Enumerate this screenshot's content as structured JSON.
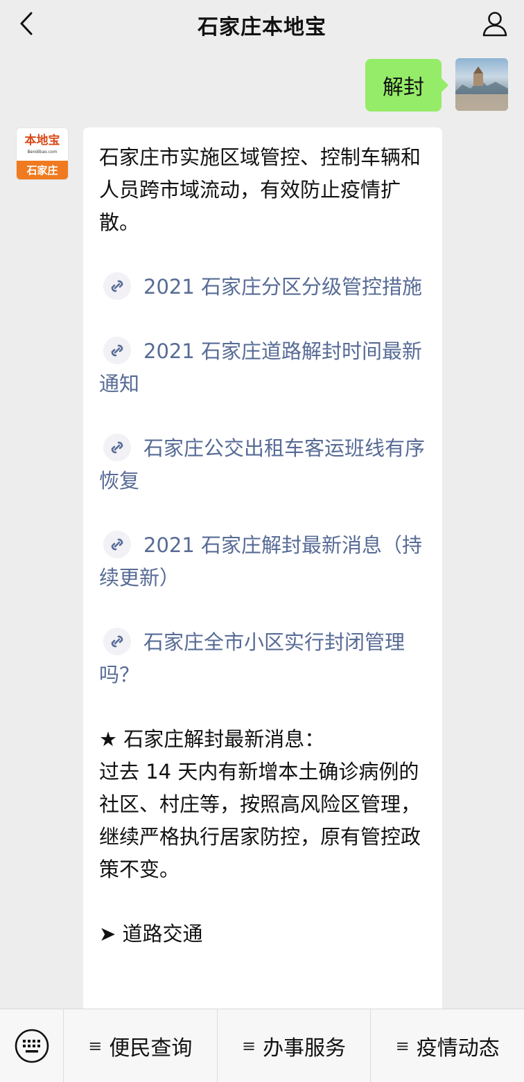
{
  "header": {
    "title": "石家庄本地宝",
    "back_icon": "chevron-left-icon",
    "profile_icon": "person-icon"
  },
  "messages": {
    "me_text": "解封",
    "bot_avatar": {
      "logo_main": "本地宝",
      "logo_sub": "Bendibao.com",
      "logo_city": "石家庄"
    },
    "bot_intro": "石家庄市实施区域管控、控制车辆和人员跨市域流动，有效防止疫情扩散。",
    "links": [
      "2021 石家庄分区分级管控措施",
      "2021 石家庄道路解封时间最新通知",
      "石家庄公交出租车客运班线有序恢复",
      "2021 石家庄解封最新消息（持续更新）",
      "石家庄全市小区实行封闭管理吗？"
    ],
    "news_heading": "★ 石家庄解封最新消息：",
    "news_body": "过去 14 天内有新增本土确诊病例的社区、村庄等，按照高风险区管理，继续严格执行居家防控，原有管控政策不变。",
    "section_heading": "➤ 道路交通"
  },
  "bottom_menu": {
    "keyboard_icon": "keyboard-icon",
    "items": [
      "便民查询",
      "办事服务",
      "疫情动态"
    ],
    "item_prefix": "≡"
  },
  "colors": {
    "background": "#ededed",
    "bubble_me": "#95ec69",
    "link": "#576b95",
    "logo_orange": "#f07a1f"
  }
}
